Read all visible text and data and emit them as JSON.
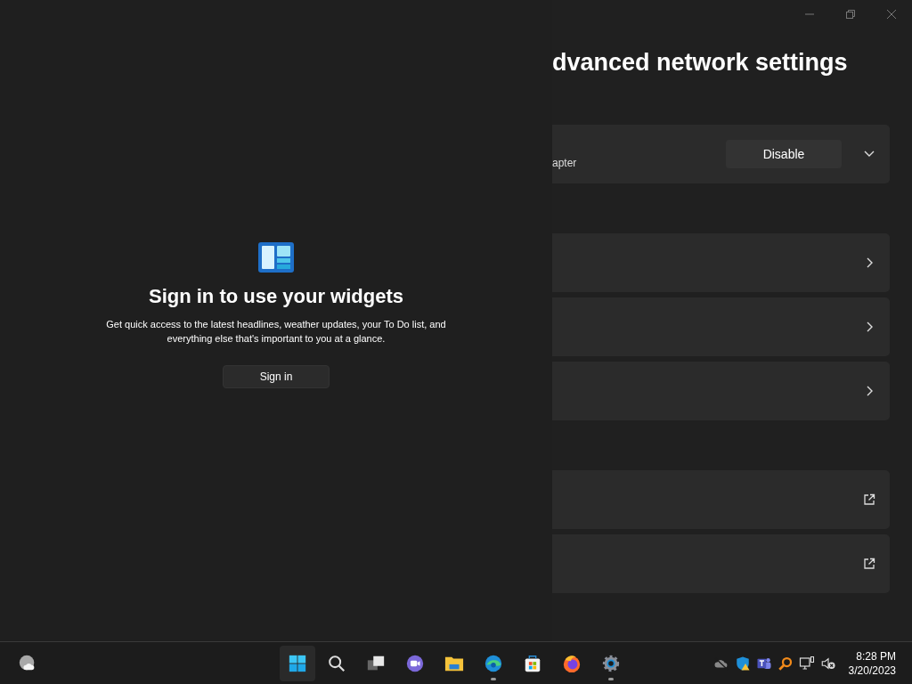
{
  "widgets": {
    "title": "Sign in to use your widgets",
    "description": "Get quick access to the latest headlines, weather updates, your To Do list, and everything else that's important to you at a glance.",
    "button": "Sign in"
  },
  "settings_window": {
    "title": "dvanced network settings",
    "groups": [
      {
        "cards": [
          {
            "kind": "adapter",
            "label": "apter",
            "button": "Disable",
            "expanded": false
          }
        ]
      },
      {
        "cards": [
          {
            "kind": "chevron"
          },
          {
            "kind": "chevron"
          },
          {
            "kind": "chevron"
          }
        ]
      },
      {
        "cards": [
          {
            "kind": "external"
          },
          {
            "kind": "external"
          }
        ]
      }
    ]
  },
  "taskbar": {
    "apps": [
      {
        "kind": "start",
        "running": false,
        "hovered": true
      },
      {
        "kind": "search",
        "running": false,
        "hovered": false
      },
      {
        "kind": "taskview",
        "running": false,
        "hovered": false
      },
      {
        "kind": "chat",
        "running": false,
        "hovered": false
      },
      {
        "kind": "explorer",
        "running": false,
        "hovered": false
      },
      {
        "kind": "edge",
        "running": true,
        "hovered": false
      },
      {
        "kind": "store",
        "running": false,
        "hovered": false
      },
      {
        "kind": "firefox",
        "running": false,
        "hovered": false
      },
      {
        "kind": "settings",
        "running": true,
        "hovered": false
      }
    ],
    "tray": [
      {
        "kind": "cloud-off"
      },
      {
        "kind": "shield-warning"
      },
      {
        "kind": "teams"
      },
      {
        "kind": "magnifier"
      },
      {
        "kind": "network"
      },
      {
        "kind": "volume-muted"
      }
    ],
    "time": "8:28 PM",
    "date": "3/20/2023"
  }
}
